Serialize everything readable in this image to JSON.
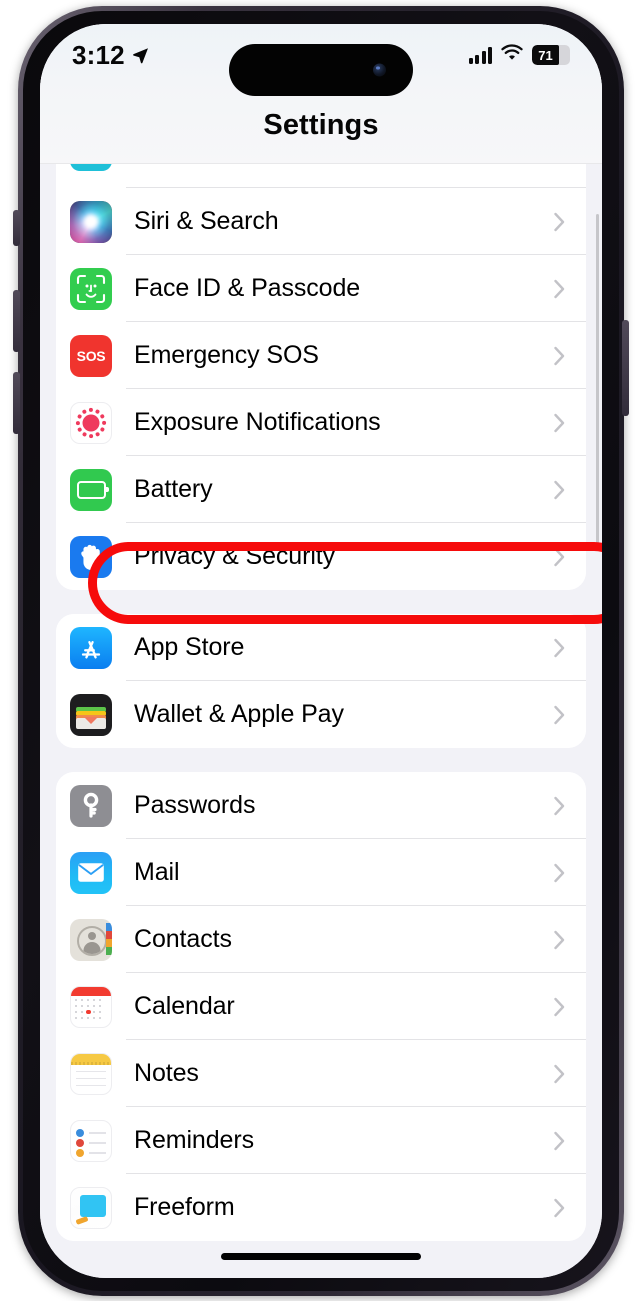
{
  "status_bar": {
    "time": "3:12",
    "location_icon": "location-arrow-icon",
    "cellular_icon": "cellular-signal-icon",
    "wifi_icon": "wifi-icon",
    "battery_percent": "71",
    "battery_icon": "battery-icon"
  },
  "nav": {
    "title": "Settings"
  },
  "groups": [
    {
      "id": "system-group",
      "clipped_top": true,
      "rows": [
        {
          "label": "Siri & Search",
          "icon": "siri-icon",
          "chevron": "chevron-right-icon"
        },
        {
          "label": "Face ID & Passcode",
          "icon": "face-id-icon",
          "chevron": "chevron-right-icon"
        },
        {
          "label": "Emergency SOS",
          "icon": "emergency-sos-icon",
          "chevron": "chevron-right-icon",
          "icon_text": "SOS"
        },
        {
          "label": "Exposure Notifications",
          "icon": "exposure-notifications-icon",
          "chevron": "chevron-right-icon"
        },
        {
          "label": "Battery",
          "icon": "battery-settings-icon",
          "chevron": "chevron-right-icon"
        },
        {
          "label": "Privacy & Security",
          "icon": "privacy-hand-icon",
          "chevron": "chevron-right-icon",
          "highlighted": true
        }
      ]
    },
    {
      "id": "store-group",
      "rows": [
        {
          "label": "App Store",
          "icon": "app-store-icon",
          "chevron": "chevron-right-icon"
        },
        {
          "label": "Wallet & Apple Pay",
          "icon": "wallet-icon",
          "chevron": "chevron-right-icon"
        }
      ]
    },
    {
      "id": "apps-group",
      "rows": [
        {
          "label": "Passwords",
          "icon": "passwords-key-icon",
          "chevron": "chevron-right-icon"
        },
        {
          "label": "Mail",
          "icon": "mail-icon",
          "chevron": "chevron-right-icon"
        },
        {
          "label": "Contacts",
          "icon": "contacts-icon",
          "chevron": "chevron-right-icon"
        },
        {
          "label": "Calendar",
          "icon": "calendar-icon",
          "chevron": "chevron-right-icon"
        },
        {
          "label": "Notes",
          "icon": "notes-icon",
          "chevron": "chevron-right-icon"
        },
        {
          "label": "Reminders",
          "icon": "reminders-icon",
          "chevron": "chevron-right-icon"
        },
        {
          "label": "Freeform",
          "icon": "freeform-icon",
          "chevron": "chevron-right-icon",
          "partially_visible": true
        }
      ]
    }
  ],
  "annotation": {
    "type": "oval-highlight",
    "target_label": "Privacy & Security",
    "color": "#f60b0b"
  },
  "home_indicator": "home-indicator"
}
